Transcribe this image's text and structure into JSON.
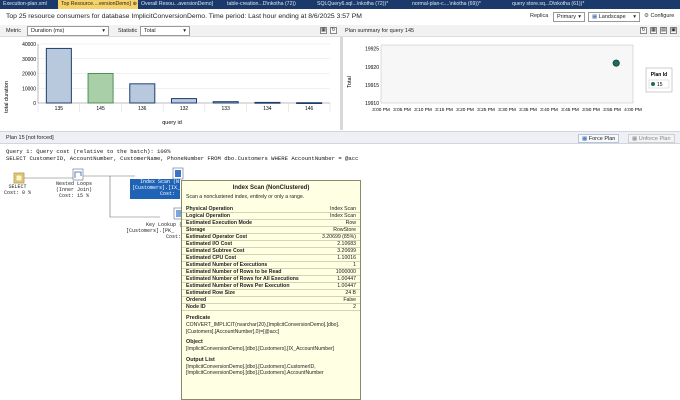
{
  "tabs": [
    {
      "label": "Execution-plan.xml",
      "active": false
    },
    {
      "label": "Top Resource....versionDemo]",
      "active": true
    },
    {
      "label": "Overall Resou...aversionDemo]",
      "active": false
    },
    {
      "label": "table-creation...D\\nkotha (72))",
      "active": false
    },
    {
      "label": "SQLQuery6.sql...\\nkotha (72))*",
      "active": false
    },
    {
      "label": "normal-plan-c....\\nkotha (69))*",
      "active": false
    },
    {
      "label": "query store.sq...D\\nkotha (61))*",
      "active": false
    }
  ],
  "header": {
    "title": "Top 25 resource consumers for database ImplicitConversionDemo. Time period: Last hour ending at 8/6/2025 3:57 PM",
    "replica_label": "Replica",
    "replica_value": "Primary",
    "layout_value": "Landscape",
    "configure_label": "Configure"
  },
  "filters": {
    "metric_label": "Metric",
    "metric_value": "Duration (ms)",
    "statistic_label": "Statistic",
    "statistic_value": "Total"
  },
  "right_panel": {
    "title": "Plan summary for query 145"
  },
  "chart_data": [
    {
      "type": "bar",
      "categories": [
        "135",
        "145",
        "136",
        "132",
        "133",
        "134",
        "146"
      ],
      "values": [
        37000,
        20000,
        13000,
        3000,
        900,
        400,
        200
      ],
      "ylabel": "total duration",
      "xlabel": "query id",
      "ylim": [
        0,
        40000
      ],
      "yticks": [
        "40000",
        "30000",
        "20000",
        "10000",
        "0"
      ],
      "colors": [
        "#1d3f6e",
        "#4f8f5e",
        "#1d3f6e",
        "#1d3f6e",
        "#1d3f6e",
        "#1d3f6e",
        "#1d3f6e"
      ]
    },
    {
      "type": "scatter",
      "x": [
        "3:56 PM"
      ],
      "y": [
        19921
      ],
      "ylabel": "Total",
      "ylim": [
        19910,
        19926
      ],
      "yticks": [
        "19925",
        "19920",
        "19915",
        "19910"
      ],
      "xticks": [
        "3:00 PM",
        "3:05 PM",
        "3:10 PM",
        "3:15 PM",
        "3:20 PM",
        "3:25 PM",
        "3:30 PM",
        "3:35 PM",
        "3:40 PM",
        "3:45 PM",
        "3:50 PM",
        "3:55 PM",
        "4:00 PM"
      ],
      "legend_title": "Plan Id",
      "legend_entry": "15",
      "point_color": "#1f6b5e"
    }
  ],
  "plan": {
    "label": "Plan 15 [not forced]",
    "force_label": "Force Plan",
    "unforce_label": "Unforce Plan",
    "query_line1": "Query 1: Query cost (relative to the batch): 100%",
    "query_line2": "SELECT CustomerID, AccountNumber, CustomerName, PhoneNumber FROM dbo.Customers WHERE AccountNumber = @acc",
    "nodes": {
      "select_l1": "SELECT",
      "select_l2": "Cost: 0 %",
      "nested_l1": "Nested Loops",
      "nested_l2": "(Inner Join)",
      "nested_l3": "Cost: 15 %",
      "index_l1": "Index Scan (N",
      "index_l2": "[Customers].[IX_",
      "index_l3": "Cost:",
      "key_l1": "Key Lookup (",
      "key_l2": "[Customers].[PK_",
      "key_l3": "Cost:"
    }
  },
  "tooltip": {
    "title": "Index Scan (NonClustered)",
    "desc": "Scan a nonclustered index, entirely or only a range.",
    "rows": [
      {
        "k": "Physical Operation",
        "v": "Index Scan"
      },
      {
        "k": "Logical Operation",
        "v": "Index Scan"
      },
      {
        "k": "Estimated Execution Mode",
        "v": "Row"
      },
      {
        "k": "Storage",
        "v": "RowStore"
      },
      {
        "k": "Estimated Operator Cost",
        "v": "3.20699 (85%)"
      },
      {
        "k": "Estimated I/O Cost",
        "v": "2.10683"
      },
      {
        "k": "Estimated Subtree Cost",
        "v": "3.20699"
      },
      {
        "k": "Estimated CPU Cost",
        "v": "1.10016"
      },
      {
        "k": "Estimated Number of Executions",
        "v": "1"
      },
      {
        "k": "Estimated Number of Rows to be Read",
        "v": "1000000"
      },
      {
        "k": "Estimated Number of Rows for All Executions",
        "v": "1.00447"
      },
      {
        "k": "Estimated Number of Rows Per Execution",
        "v": "1.00447"
      },
      {
        "k": "Estimated Row Size",
        "v": "24 B"
      },
      {
        "k": "Ordered",
        "v": "False"
      },
      {
        "k": "Node ID",
        "v": "2"
      }
    ],
    "predicate_label": "Predicate",
    "predicate_text": "CONVERT_IMPLICIT(nvarchar(20),[ImplicitConversionDemo].[dbo].[Customers].[AccountNumber],0)=[@acc]",
    "object_label": "Object",
    "object_text": "[ImplicitConversionDemo].[dbo].[Customers].[IX_AccountNumber]",
    "output_label": "Output List",
    "output_text1": "[ImplicitConversionDemo].[dbo].[Customers].CustomerID,",
    "output_text2": "[ImplicitConversionDemo].[dbo].[Customers].AccountNumber"
  }
}
